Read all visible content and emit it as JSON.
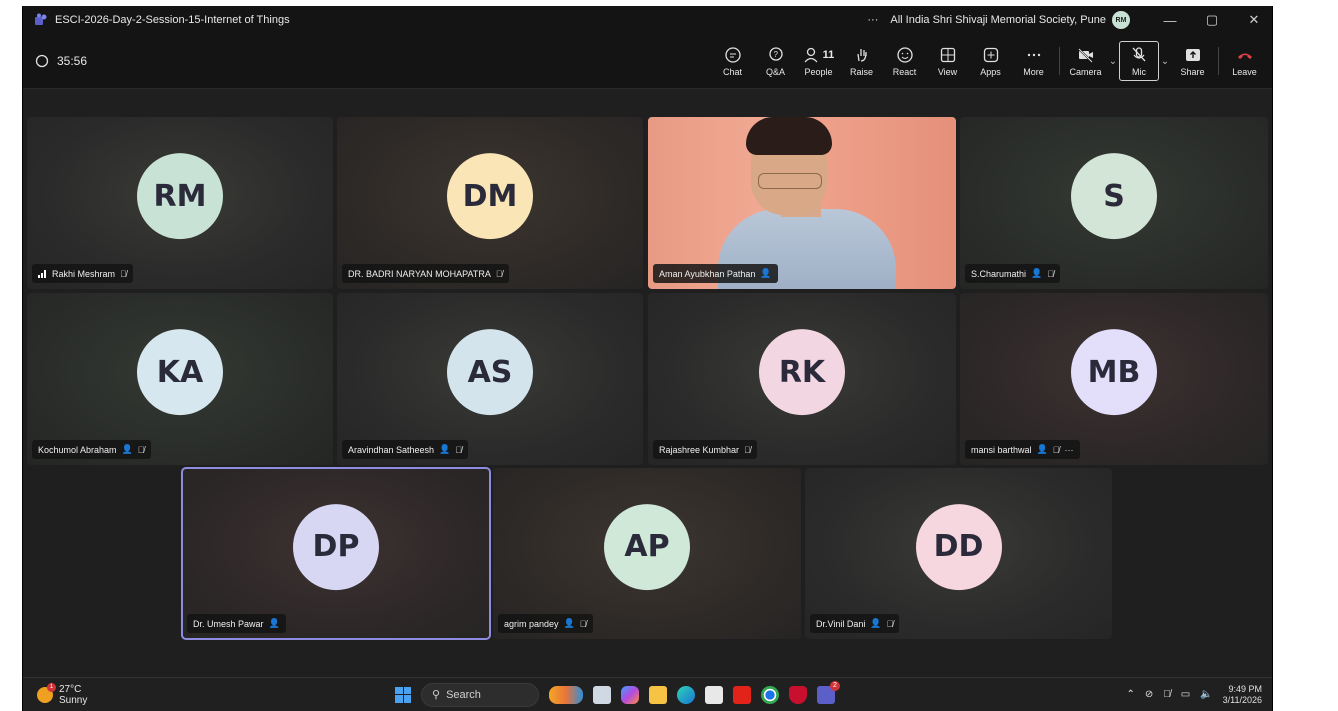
{
  "window": {
    "title": "ESCI-2026-Day-2-Session-15-Internet of Things",
    "more_glyph": "···",
    "org": "All India Shri Shivaji Memorial Society, Pune",
    "user_initials": "RM",
    "minimize": "—",
    "restore": "▢",
    "close": "✕"
  },
  "toolbar": {
    "timer": "35:56",
    "chat": "Chat",
    "qa": "Q&A",
    "people": "People",
    "people_count": "11",
    "raise": "Raise",
    "react": "React",
    "view": "View",
    "apps": "Apps",
    "more": "More",
    "camera": "Camera",
    "mic": "Mic",
    "share": "Share",
    "leave": "Leave"
  },
  "participants": [
    {
      "initials": "RM",
      "name": "Rakhi Meshram",
      "color": "#c8e3d6",
      "signal": true,
      "muted": true
    },
    {
      "initials": "DM",
      "name": "DR. BADRI NARYAN MOHAPATRA",
      "color": "#f9e5b5",
      "muted": true
    },
    {
      "initials": "",
      "name": "Aman Ayubkhan Pathan",
      "video": true,
      "presenter": true
    },
    {
      "initials": "S",
      "name": "S.Charumathi",
      "color": "#d3e5d6",
      "presenter": true,
      "muted": true
    },
    {
      "initials": "KA",
      "name": "Kochumol Abraham",
      "color": "#d7e7f0",
      "presenter": true,
      "muted": true
    },
    {
      "initials": "AS",
      "name": "Aravindhan Satheesh",
      "color": "#d4e4ec",
      "presenter": true,
      "muted": true
    },
    {
      "initials": "RK",
      "name": "Rajashree Kumbhar",
      "color": "#f2d7e3",
      "muted": true
    },
    {
      "initials": "MB",
      "name": "mansi barthwal",
      "color": "#e3defa",
      "presenter": true,
      "muted": true,
      "more": "···"
    },
    {
      "initials": "DP",
      "name": "Dr. Umesh Pawar",
      "color": "#d8d7f3",
      "presenter": true,
      "active": true
    },
    {
      "initials": "AP",
      "name": "agrim pandey",
      "color": "#cfe8d8",
      "presenter": true,
      "muted": true
    },
    {
      "initials": "DD",
      "name": "Dr.Vinil Dani",
      "color": "#f6d6df",
      "presenter": true,
      "muted": true
    }
  ],
  "taskbar": {
    "temp": "27°C",
    "weather": "Sunny",
    "weather_badge": "1",
    "search": "Search",
    "teams_badge": "2",
    "time": "9:49 PM",
    "date": "3/11/2026"
  }
}
